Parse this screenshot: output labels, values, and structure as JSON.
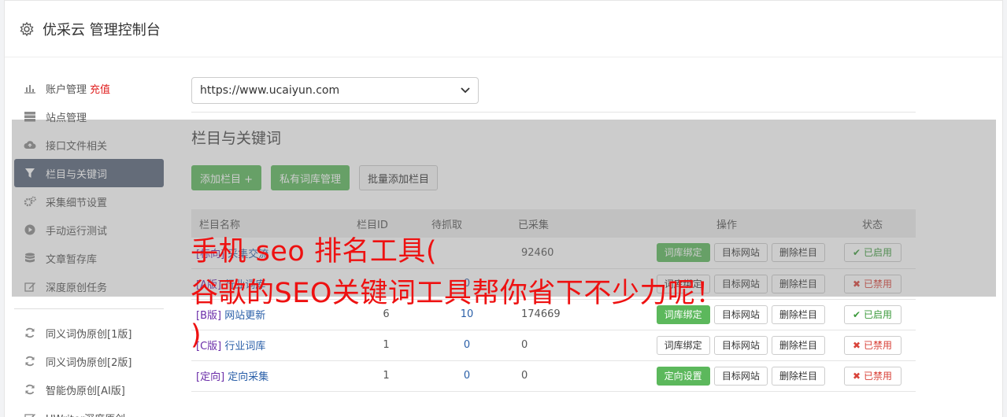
{
  "app": {
    "title": "优采云 管理控制台"
  },
  "sidebar": {
    "group1": [
      {
        "icon": "bar-chart-icon",
        "label": "账户管理",
        "extra": "充值"
      },
      {
        "icon": "server-icon",
        "label": "站点管理"
      },
      {
        "icon": "cloud-upload-icon",
        "label": "接口文件相关"
      },
      {
        "icon": "filter-icon",
        "label": "栏目与关键词",
        "active": true
      },
      {
        "icon": "cogs-icon",
        "label": "采集细节设置"
      },
      {
        "icon": "play-circle-icon",
        "label": "手动运行测试"
      },
      {
        "icon": "database-icon",
        "label": "文章暂存库"
      },
      {
        "icon": "edit-icon",
        "label": "深度原创任务"
      }
    ],
    "group2": [
      {
        "icon": "refresh-icon",
        "label": "同义词伪原创[1版]"
      },
      {
        "icon": "refresh-icon",
        "label": "同义词伪原创[2版]"
      },
      {
        "icon": "refresh-icon",
        "label": "智能伪原创[AI版]"
      },
      {
        "icon": "edit-icon",
        "label": "UWriter深度原创"
      }
    ]
  },
  "main": {
    "site_select": "https://www.ucaiyun.com",
    "section_title": "栏目与关键词",
    "buttons": {
      "add": "添加栏目 +",
      "private_lib": "私有词库管理",
      "batch_add": "批量添加栏目"
    },
    "table": {
      "headers": [
        "栏目名称",
        "栏目ID",
        "待抓取",
        "已采集",
        "操作",
        "状态"
      ],
      "rows": [
        {
          "tag": "[标向]",
          "name": "采集交流",
          "id": "",
          "pending": "",
          "collected": "92460",
          "op1": "词库绑定",
          "op1_green": true,
          "op2": "目标网站",
          "op3": "删除栏目",
          "status": "已启用",
          "enabled": true
        },
        {
          "tag": "[A版]",
          "name": "行业词库",
          "id": "",
          "pending": "0",
          "collected": "",
          "op1": "词库绑定",
          "op1_green": false,
          "op2": "目标网站",
          "op3": "删除栏目",
          "status": "已禁用",
          "enabled": false
        },
        {
          "tag": "[B版]",
          "name": "网站更新",
          "id": "6",
          "pending": "10",
          "collected": "174669",
          "op1": "词库绑定",
          "op1_green": true,
          "op2": "目标网站",
          "op3": "删除栏目",
          "status": "已启用",
          "enabled": true
        },
        {
          "tag": "[C版]",
          "name": "行业词库",
          "id": "1",
          "pending": "0",
          "collected": "0",
          "op1": "词库绑定",
          "op1_green": false,
          "op2": "目标网站",
          "op3": "删除栏目",
          "status": "已禁用",
          "enabled": false
        },
        {
          "tag": "[定向]",
          "name": "定向采集",
          "id": "1",
          "pending": "0",
          "collected": "0",
          "op1": "定向设置",
          "op1_green": true,
          "op2": "目标网站",
          "op3": "删除栏目",
          "status": "已禁用",
          "enabled": false
        }
      ]
    }
  },
  "overlay_text": {
    "line1": "手机 seo 排名工具(",
    "line2": "谷歌的SEO关键词工具帮你省下不少力呢！",
    "line3": ")"
  },
  "colors": {
    "active_nav": "#58657a",
    "green": "#5cb85c",
    "red_text": "#ee1111"
  }
}
